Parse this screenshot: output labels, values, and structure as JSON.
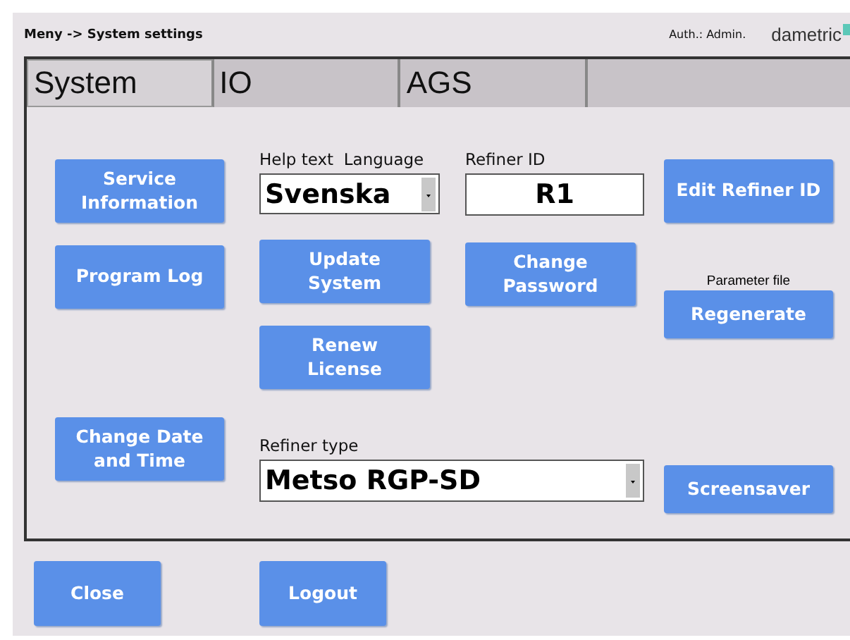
{
  "header": {
    "breadcrumb": "Meny -> System settings",
    "auth": "Auth.: Admin.",
    "logo": "dametric"
  },
  "tabs": [
    {
      "label": "System",
      "selected": true
    },
    {
      "label": "IO",
      "selected": false
    },
    {
      "label": "AGS",
      "selected": false
    }
  ],
  "column_1": [
    "Service Information",
    "Program Log",
    "Change Date and Time"
  ],
  "help_language": {
    "label": "Help text  Language",
    "value": "Svenska"
  },
  "column_2": [
    "Update System",
    "Renew License"
  ],
  "refiner_type": {
    "label": "Refiner type",
    "value": "Metso RGP-SD"
  },
  "refiner_id": {
    "label": "Refiner ID",
    "value": "R1"
  },
  "change_password": "Change Password",
  "edit_refiner_id": "Edit Refiner ID",
  "parameter_file": {
    "label": "Parameter file",
    "button": "Regenerate"
  },
  "screensaver": "Screensaver",
  "footer_buttons": [
    "Close",
    "Logout"
  ]
}
